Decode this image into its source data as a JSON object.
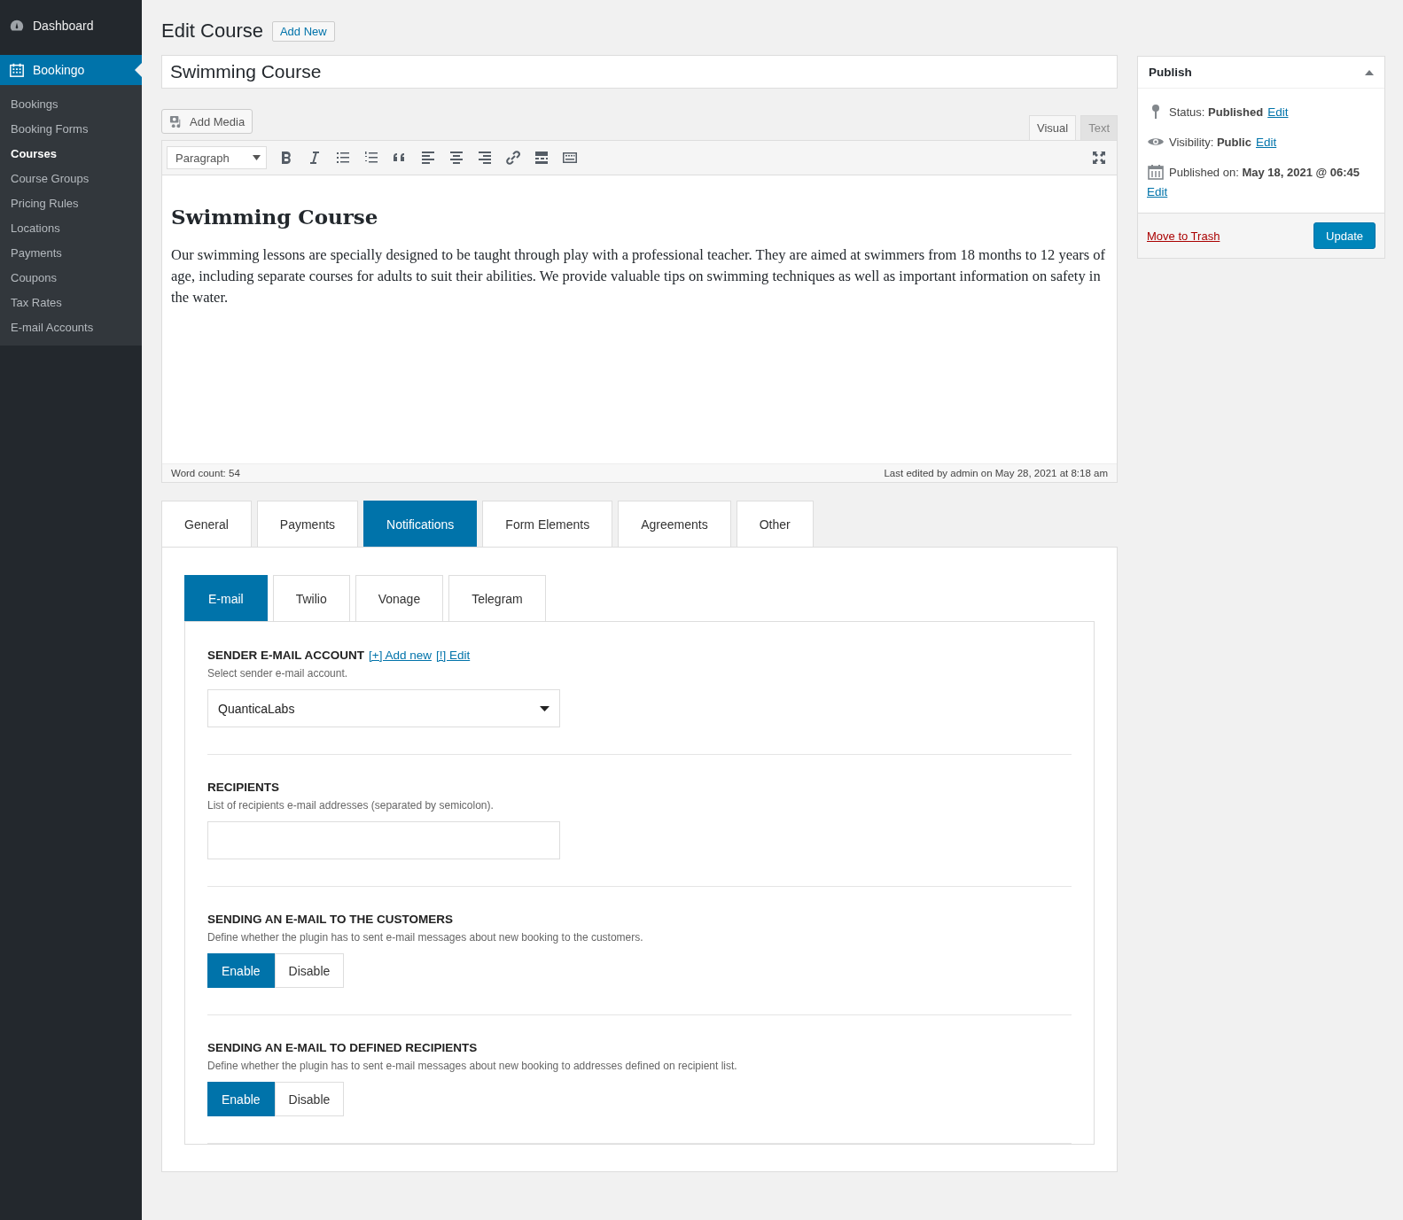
{
  "sidebar": {
    "items": [
      {
        "label": "Dashboard",
        "selected": false
      },
      {
        "label": "Bookingo",
        "selected": true
      }
    ],
    "submenu": [
      {
        "label": "Bookings",
        "selected": false
      },
      {
        "label": "Booking Forms",
        "selected": false
      },
      {
        "label": "Courses",
        "selected": true
      },
      {
        "label": "Course Groups",
        "selected": false
      },
      {
        "label": "Pricing Rules",
        "selected": false
      },
      {
        "label": "Locations",
        "selected": false
      },
      {
        "label": "Payments",
        "selected": false
      },
      {
        "label": "Coupons",
        "selected": false
      },
      {
        "label": "Tax Rates",
        "selected": false
      },
      {
        "label": "E-mail Accounts",
        "selected": false
      }
    ]
  },
  "page": {
    "title": "Edit Course",
    "add_new": "Add New"
  },
  "post_title": "Swimming Course",
  "editor": {
    "add_media": "Add Media",
    "tabs": [
      {
        "label": "Visual",
        "selected": true
      },
      {
        "label": "Text",
        "selected": false
      }
    ],
    "format": "Paragraph",
    "heading": "Swimming Course",
    "body": "Our swimming lessons are specially designed to be taught through play with a professional teacher. They are aimed at swimmers from 18 months to 12 years of age, including separate courses for adults to suit their abilities. We provide valuable tips on swimming techniques as well as important information on safety in the water.",
    "word_count": "Word count: 54",
    "last_edited": "Last edited by admin on May 28, 2021 at 8:18 am"
  },
  "tabs": [
    {
      "label": "General",
      "selected": false
    },
    {
      "label": "Payments",
      "selected": false
    },
    {
      "label": "Notifications",
      "selected": true
    },
    {
      "label": "Form Elements",
      "selected": false
    },
    {
      "label": "Agreements",
      "selected": false
    },
    {
      "label": "Other",
      "selected": false
    }
  ],
  "subtabs": [
    {
      "label": "E-mail",
      "selected": true
    },
    {
      "label": "Twilio",
      "selected": false
    },
    {
      "label": "Vonage",
      "selected": false
    },
    {
      "label": "Telegram",
      "selected": false
    }
  ],
  "sections": [
    {
      "kind": "select",
      "title": "SENDER E-MAIL ACCOUNT",
      "links": [
        "[+] Add new",
        "[!] Edit"
      ],
      "description": "Select sender e-mail account.",
      "value": "QuanticaLabs"
    },
    {
      "kind": "text",
      "title": "RECIPIENTS",
      "description": "List of recipients e-mail addresses (separated by semicolon)."
    },
    {
      "kind": "toggle",
      "title": "SENDING AN E-MAIL TO THE CUSTOMERS",
      "description": "Define whether the plugin has to sent e-mail messages about new booking to the customers.",
      "options": [
        {
          "label": "Enable",
          "selected": true
        },
        {
          "label": "Disable",
          "selected": false
        }
      ]
    },
    {
      "kind": "toggle",
      "title": "SENDING AN E-MAIL TO DEFINED RECIPIENTS",
      "description": "Define whether the plugin has to sent e-mail messages about new booking to addresses defined on recipient list.",
      "options": [
        {
          "label": "Enable",
          "selected": true
        },
        {
          "label": "Disable",
          "selected": false
        }
      ]
    }
  ],
  "publish": {
    "title": "Publish",
    "status": "Status: **Published**",
    "visibility": "Visibility: **Public**",
    "published_on": "Published on: **May 18, 2021 @ 06:45**",
    "edit_links": [
      "Edit",
      "Edit",
      "Edit"
    ],
    "trash": "Move to Trash",
    "update": "Update"
  }
}
